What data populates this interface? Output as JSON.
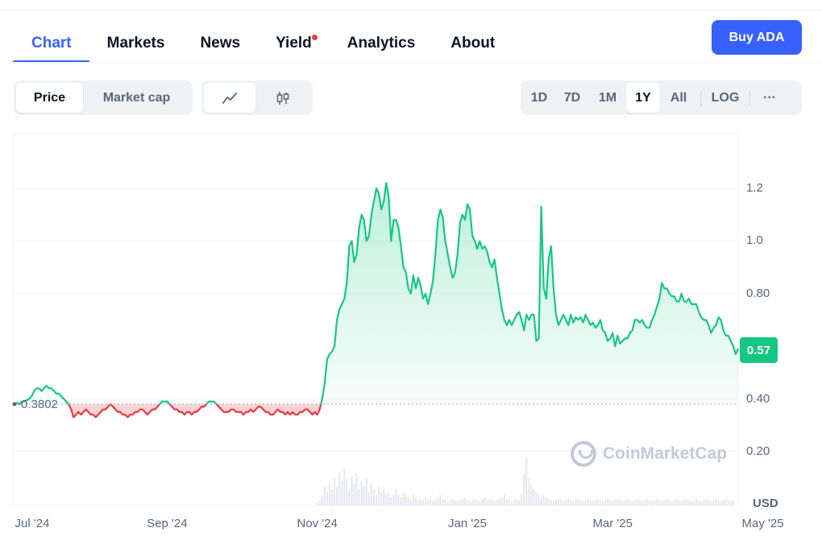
{
  "tabs": [
    {
      "label": "Chart",
      "active": true
    },
    {
      "label": "Markets"
    },
    {
      "label": "News"
    },
    {
      "label": "Yield",
      "new_dot": true
    },
    {
      "label": "Analytics"
    },
    {
      "label": "About"
    }
  ],
  "buy_button": "Buy ADA",
  "metric_toggle": [
    "Price",
    "Market cap"
  ],
  "chart_style_icons": [
    "line-chart-icon",
    "candlestick-icon"
  ],
  "ranges": [
    "1D",
    "7D",
    "1M",
    "1Y",
    "All"
  ],
  "selected_range": "1Y",
  "log_label": "LOG",
  "more_label": "···",
  "watermark": "CoinMarketCap",
  "chart_data": {
    "type": "area",
    "currency": "USD",
    "current_price": "0.57",
    "reference_price": "0.3802",
    "ylim": [
      0.0,
      1.4
    ],
    "yticks": [
      "1.2",
      "1.0",
      "0.80",
      "0.40",
      "0.20"
    ],
    "ytick_values": [
      1.2,
      1.0,
      0.8,
      0.4,
      0.2
    ],
    "xticks": [
      "Jul '24",
      "Sep '24",
      "Nov '24",
      "Jan '25",
      "Mar '25",
      "May '25"
    ],
    "xtick_index": [
      0,
      62,
      123,
      184,
      243,
      304
    ],
    "colors": {
      "up": "#16c784",
      "down": "#ea3943",
      "accent": "#3861fb"
    },
    "series": [
      {
        "values": [
          0.38,
          0.385,
          0.38,
          0.39,
          0.39,
          0.395,
          0.4,
          0.41,
          0.43,
          0.44,
          0.44,
          0.43,
          0.44,
          0.45,
          0.44,
          0.44,
          0.43,
          0.42,
          0.42,
          0.41,
          0.4,
          0.39,
          0.38,
          0.36,
          0.33,
          0.34,
          0.35,
          0.34,
          0.35,
          0.36,
          0.35,
          0.34,
          0.34,
          0.33,
          0.34,
          0.35,
          0.36,
          0.36,
          0.37,
          0.38,
          0.37,
          0.36,
          0.35,
          0.35,
          0.34,
          0.34,
          0.33,
          0.34,
          0.34,
          0.35,
          0.35,
          0.36,
          0.36,
          0.35,
          0.34,
          0.35,
          0.36,
          0.36,
          0.37,
          0.38,
          0.39,
          0.39,
          0.39,
          0.38,
          0.37,
          0.36,
          0.36,
          0.35,
          0.35,
          0.34,
          0.35,
          0.35,
          0.34,
          0.35,
          0.35,
          0.36,
          0.37,
          0.37,
          0.38,
          0.39,
          0.39,
          0.39,
          0.38,
          0.37,
          0.36,
          0.35,
          0.35,
          0.35,
          0.36,
          0.36,
          0.35,
          0.35,
          0.35,
          0.34,
          0.35,
          0.35,
          0.36,
          0.35,
          0.36,
          0.37,
          0.37,
          0.36,
          0.35,
          0.35,
          0.34,
          0.34,
          0.35,
          0.36,
          0.35,
          0.35,
          0.34,
          0.35,
          0.34,
          0.35,
          0.34,
          0.34,
          0.35,
          0.35,
          0.36,
          0.36,
          0.35,
          0.34,
          0.35,
          0.34,
          0.36,
          0.4,
          0.46,
          0.55,
          0.57,
          0.58,
          0.6,
          0.7,
          0.74,
          0.76,
          0.78,
          0.84,
          0.98,
          1.0,
          0.92,
          0.95,
          1.05,
          1.1,
          1.08,
          1.0,
          1.02,
          1.1,
          1.15,
          1.2,
          1.18,
          1.12,
          1.15,
          1.22,
          1.17,
          1.0,
          1.08,
          1.08,
          1.05,
          0.98,
          0.9,
          0.88,
          0.82,
          0.8,
          0.87,
          0.82,
          0.86,
          0.83,
          0.78,
          0.8,
          0.76,
          0.8,
          0.85,
          0.95,
          1.08,
          1.12,
          1.09,
          1.0,
          0.95,
          0.9,
          0.86,
          0.88,
          0.95,
          1.07,
          1.1,
          1.08,
          1.14,
          1.12,
          1.02,
          1.0,
          0.97,
          1.0,
          0.97,
          0.98,
          0.96,
          0.92,
          0.9,
          0.93,
          0.86,
          0.8,
          0.74,
          0.7,
          0.68,
          0.7,
          0.68,
          0.7,
          0.72,
          0.73,
          0.7,
          0.66,
          0.72,
          0.7,
          0.72,
          0.72,
          0.62,
          0.63,
          1.13,
          0.82,
          0.78,
          0.93,
          0.98,
          0.82,
          0.72,
          0.68,
          0.7,
          0.72,
          0.7,
          0.68,
          0.72,
          0.69,
          0.71,
          0.7,
          0.71,
          0.69,
          0.72,
          0.7,
          0.68,
          0.69,
          0.67,
          0.68,
          0.7,
          0.66,
          0.65,
          0.62,
          0.63,
          0.65,
          0.6,
          0.64,
          0.61,
          0.62,
          0.63,
          0.63,
          0.65,
          0.66,
          0.7,
          0.7,
          0.69,
          0.7,
          0.68,
          0.67,
          0.67,
          0.7,
          0.72,
          0.75,
          0.78,
          0.84,
          0.82,
          0.82,
          0.8,
          0.79,
          0.79,
          0.77,
          0.77,
          0.8,
          0.77,
          0.77,
          0.78,
          0.76,
          0.76,
          0.76,
          0.73,
          0.71,
          0.7,
          0.7,
          0.68,
          0.65,
          0.67,
          0.68,
          0.71,
          0.7,
          0.66,
          0.64,
          0.64,
          0.62,
          0.6,
          0.57,
          0.59
        ]
      }
    ],
    "volume": [
      0,
      0,
      0,
      0,
      0,
      0,
      0,
      0,
      0,
      0,
      0,
      0,
      0,
      0,
      0,
      0,
      0,
      0,
      0,
      0,
      0,
      0,
      0,
      0,
      0,
      0,
      0,
      0,
      0,
      0,
      0,
      0,
      0,
      0,
      0,
      0,
      0,
      0,
      0,
      0,
      0,
      0,
      0,
      0,
      0,
      0,
      0,
      0,
      0,
      0,
      0,
      0,
      0,
      0,
      0,
      0,
      0,
      0,
      0,
      0,
      0,
      0,
      0,
      0,
      0,
      0,
      0,
      0,
      0,
      0,
      0,
      0,
      0,
      0,
      0,
      0,
      0,
      0,
      0,
      0,
      0,
      0,
      0,
      0,
      0,
      0,
      0,
      0,
      0,
      0,
      0,
      0,
      0,
      0,
      0,
      0,
      0,
      0,
      0,
      0,
      0,
      0,
      0,
      0,
      0,
      0,
      0,
      0,
      0,
      0,
      0,
      0,
      0,
      0,
      0,
      0,
      0,
      0,
      0,
      0,
      0,
      0,
      0,
      0.05,
      0.1,
      0.2,
      0.35,
      0.25,
      0.4,
      0.3,
      0.5,
      0.35,
      0.6,
      0.45,
      0.7,
      0.5,
      0.3,
      0.55,
      0.4,
      0.6,
      0.3,
      0.45,
      0.35,
      0.5,
      0.25,
      0.4,
      0.3,
      0.2,
      0.35,
      0.25,
      0.3,
      0.2,
      0.25,
      0.15,
      0.2,
      0.3,
      0.2,
      0.15,
      0.25,
      0.2,
      0.15,
      0.1,
      0.2,
      0.15,
      0.1,
      0.12,
      0.1,
      0.15,
      0.1,
      0.12,
      0.08,
      0.1,
      0.15,
      0.2,
      0.12,
      0.1,
      0.08,
      0.1,
      0.12,
      0.1,
      0.08,
      0.1,
      0.12,
      0.15,
      0.1,
      0.08,
      0.1,
      0.12,
      0.1,
      0.08,
      0.12,
      0.15,
      0.1,
      0.12,
      0.1,
      0.08,
      0.1,
      0.12,
      0.15,
      0.2,
      0.12,
      0.1,
      0.08,
      0.1,
      0.12,
      0.1,
      0.2,
      0.6,
      0.9,
      0.5,
      0.4,
      0.3,
      0.25,
      0.2,
      0.15,
      0.2,
      0.15,
      0.12,
      0.1,
      0.08,
      0.1,
      0.12,
      0.1,
      0.08,
      0.1,
      0.12,
      0.1,
      0.08,
      0.1,
      0.12,
      0.1,
      0.08,
      0.1,
      0.12,
      0.1,
      0.08,
      0.1,
      0.12,
      0.1,
      0.08,
      0.1,
      0.12,
      0.1,
      0.08,
      0.1,
      0.12,
      0.1,
      0.08,
      0.1,
      0.12,
      0.1,
      0.08,
      0.1,
      0.12,
      0.1,
      0.08,
      0.1,
      0.12,
      0.1,
      0.08,
      0.1,
      0.12,
      0.1,
      0.08,
      0.1,
      0.12,
      0.1,
      0.08,
      0.1,
      0.12,
      0.1,
      0.08,
      0.1,
      0.12,
      0.1,
      0.08,
      0.1,
      0.12,
      0.1,
      0.08,
      0.1,
      0.12,
      0.1,
      0.08,
      0.1,
      0.12,
      0.1,
      0.08,
      0.1,
      0.12,
      0.1,
      0.08,
      0.1
    ]
  }
}
